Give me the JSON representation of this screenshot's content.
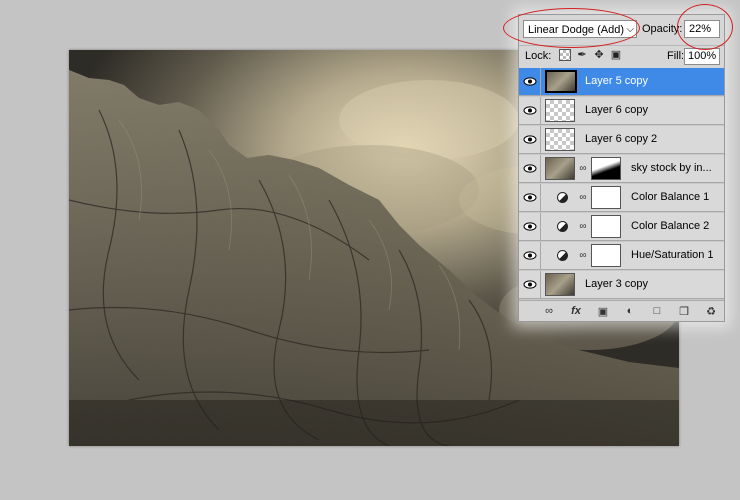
{
  "layers_panel": {
    "blend_mode": "Linear Dodge (Add)",
    "opacity_label": "Opacity:",
    "opacity_value": "22%",
    "lock_label": "Lock:",
    "fill_label": "Fill:",
    "fill_value": "100%",
    "layers": [
      {
        "name": "Layer 5 copy",
        "selected": true,
        "thumbnail": "texture"
      },
      {
        "name": "Layer 6 copy",
        "selected": false,
        "thumbnail": "transparent"
      },
      {
        "name": "Layer 6 copy 2",
        "selected": false,
        "thumbnail": "transparent"
      },
      {
        "name": "sky stock by in...",
        "selected": false,
        "thumbnail": "photo-with-mask"
      },
      {
        "name": "Color Balance 1",
        "selected": false,
        "thumbnail": "adjustment"
      },
      {
        "name": "Color Balance 2",
        "selected": false,
        "thumbnail": "adjustment"
      },
      {
        "name": "Hue/Saturation 1",
        "selected": false,
        "thumbnail": "adjustment"
      },
      {
        "name": "Layer 3 copy",
        "selected": false,
        "thumbnail": "texture"
      }
    ]
  },
  "colors": {
    "selection": "#3e8ae6",
    "annotation": "#d42020",
    "workspace": "#c4c4c4"
  }
}
